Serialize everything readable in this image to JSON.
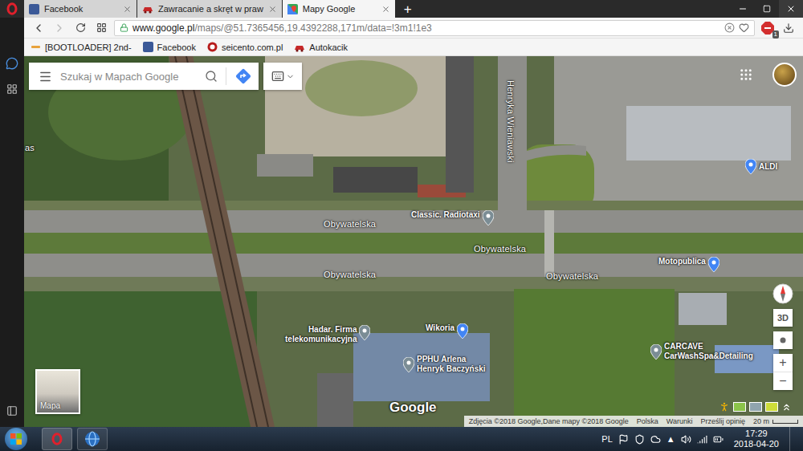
{
  "browser": {
    "tabs": [
      {
        "label": "Facebook",
        "selected": false
      },
      {
        "label": "Zawracanie a skręt w praw",
        "selected": false
      },
      {
        "label": "Mapy Google",
        "selected": true
      }
    ],
    "new_tab": "+",
    "address": {
      "host": "www.google.pl",
      "path": "/maps/@51.7365456,19.4392288,171m/data=!3m1!1e3"
    },
    "adblock_badge": "1",
    "bookmarks": [
      "[BOOTLOADER] 2nd-",
      "Facebook",
      "seicento.com.pl",
      "Autokacik"
    ]
  },
  "map": {
    "search": {
      "placeholder": "Szukaj w Mapach Google"
    },
    "streets": [
      "as",
      "Obywatelska",
      "Obywatelska",
      "Obywatelska",
      "Obywatelska",
      "Henryka Wieniawski"
    ],
    "places": [
      {
        "lines": [
          "Classic. Radiotaxi"
        ],
        "color": "#7b8d95"
      },
      {
        "lines": [
          "ALDI"
        ],
        "color": "#4285f4"
      },
      {
        "lines": [
          "Motopublica"
        ],
        "color": "#4285f4"
      },
      {
        "lines": [
          "Hadar. Firma",
          "telekomunikacyjna"
        ],
        "color": "#7b8d95"
      },
      {
        "lines": [
          "Wikoria"
        ],
        "color": "#4285f4"
      },
      {
        "lines": [
          "PPHU Arlena",
          "Henryk Baczyński"
        ],
        "color": "#7b8d95"
      },
      {
        "lines": [
          "CARCAVE",
          "CarWashSpa&Detailing"
        ],
        "color": "#7b8d95"
      }
    ],
    "layer_toggle": "Mapa",
    "view_3d": "3D",
    "zoom_in": "+",
    "zoom_out": "−",
    "logo": "Google",
    "footer": [
      "Zdjęcia ©2018 Google,Dane mapy ©2018 Google",
      "Polska",
      "Warunki",
      "Prześlij opinię",
      "20 m"
    ]
  },
  "taskbar": {
    "language": "PL",
    "tray_expand": "▲",
    "time": "17:29",
    "date": "2018-04-20"
  }
}
